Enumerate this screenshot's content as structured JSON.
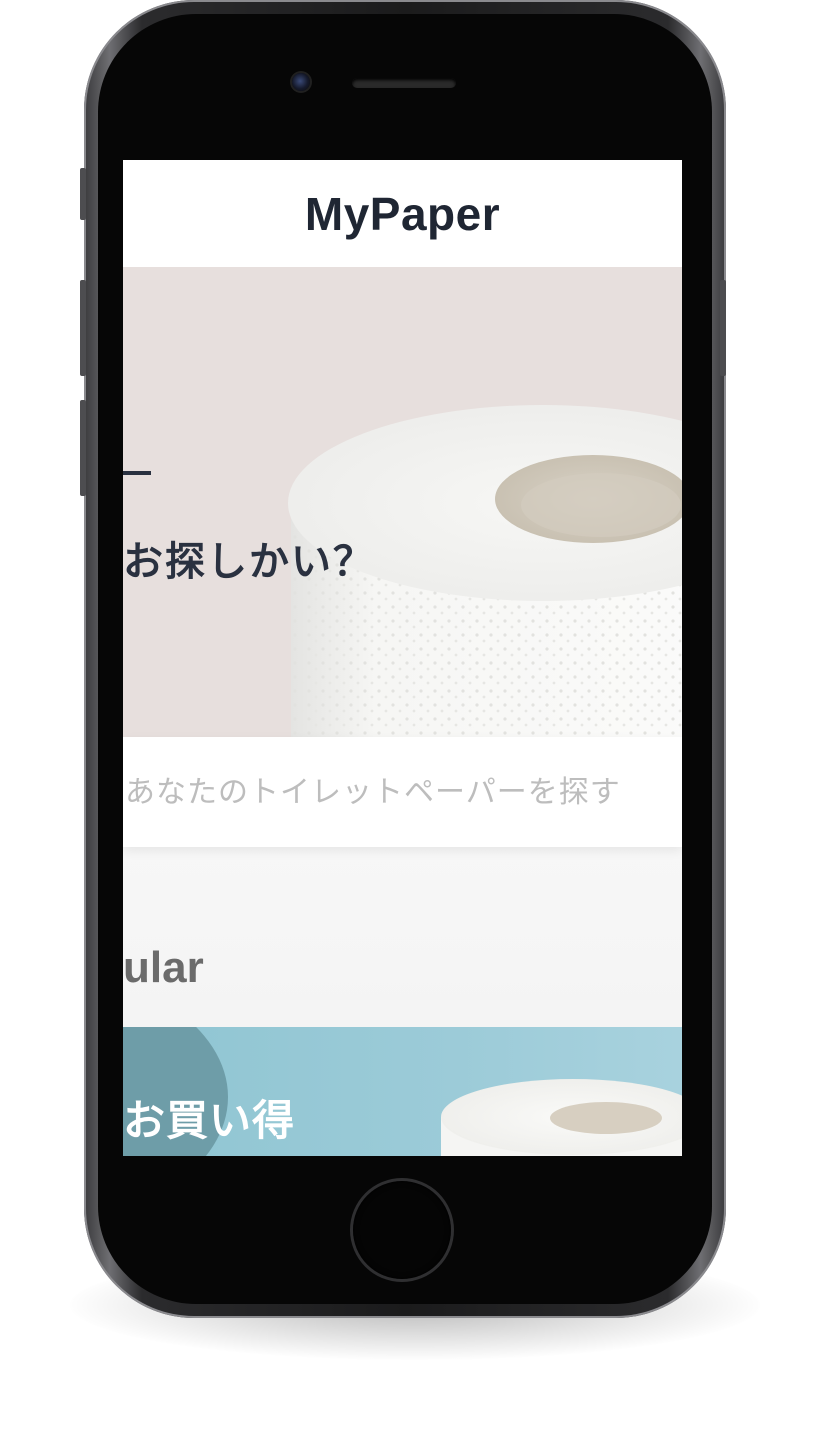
{
  "app": {
    "title": "MyPaper"
  },
  "hero": {
    "title_fragment": "お探しかい？",
    "image_icon": "toilet-paper-roll"
  },
  "search": {
    "placeholder": "あなたのトイレットペーパーを探す",
    "value": ""
  },
  "popular": {
    "title_fragment": "ular"
  },
  "deal": {
    "title_fragment": "お買い得",
    "image_icon": "toilet-paper-roll"
  },
  "colors": {
    "hero_bg": "#e7dfdd",
    "title_text": "#1f2633",
    "deal_bg": "#9ccbd8",
    "placeholder_text": "#bdbdbd"
  }
}
